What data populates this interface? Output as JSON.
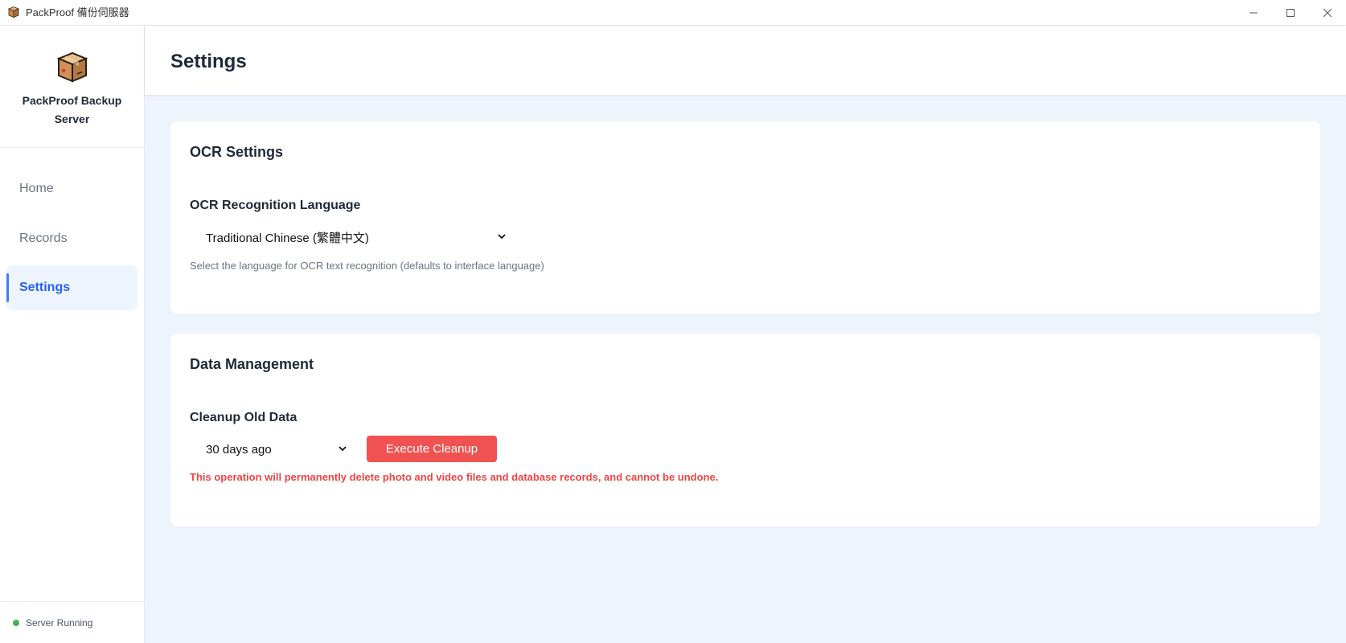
{
  "window": {
    "title": "PackProof 備份伺服器",
    "app_icon": "package-box-icon",
    "controls": [
      "minimize-icon",
      "maximize-icon",
      "close-icon"
    ]
  },
  "sidebar": {
    "brand": {
      "logo": "package-box-icon",
      "name": "PackProof Backup Server"
    },
    "items": [
      {
        "label": "Home",
        "active": false
      },
      {
        "label": "Records",
        "active": false
      },
      {
        "label": "Settings",
        "active": true
      }
    ],
    "status": {
      "label": "Server Running",
      "color": "#4caf50"
    }
  },
  "header": {
    "title": "Settings"
  },
  "ocr_settings": {
    "title": "OCR Settings",
    "language_label": "OCR Recognition Language",
    "language_value": "Traditional Chinese (繁體中文)",
    "hint": "Select the language for OCR text recognition (defaults to interface language)"
  },
  "data_management": {
    "title": "Data Management",
    "cleanup_label": "Cleanup Old Data",
    "cleanup_value": "30 days ago",
    "cleanup_button": "Execute Cleanup",
    "warning": "This operation will permanently delete photo and video files and database records, and cannot be undone."
  },
  "colors": {
    "accent": "#3b82f6",
    "active_bg": "#eef4fe",
    "danger": "#f05252",
    "main_bg": "#eef4fc"
  }
}
